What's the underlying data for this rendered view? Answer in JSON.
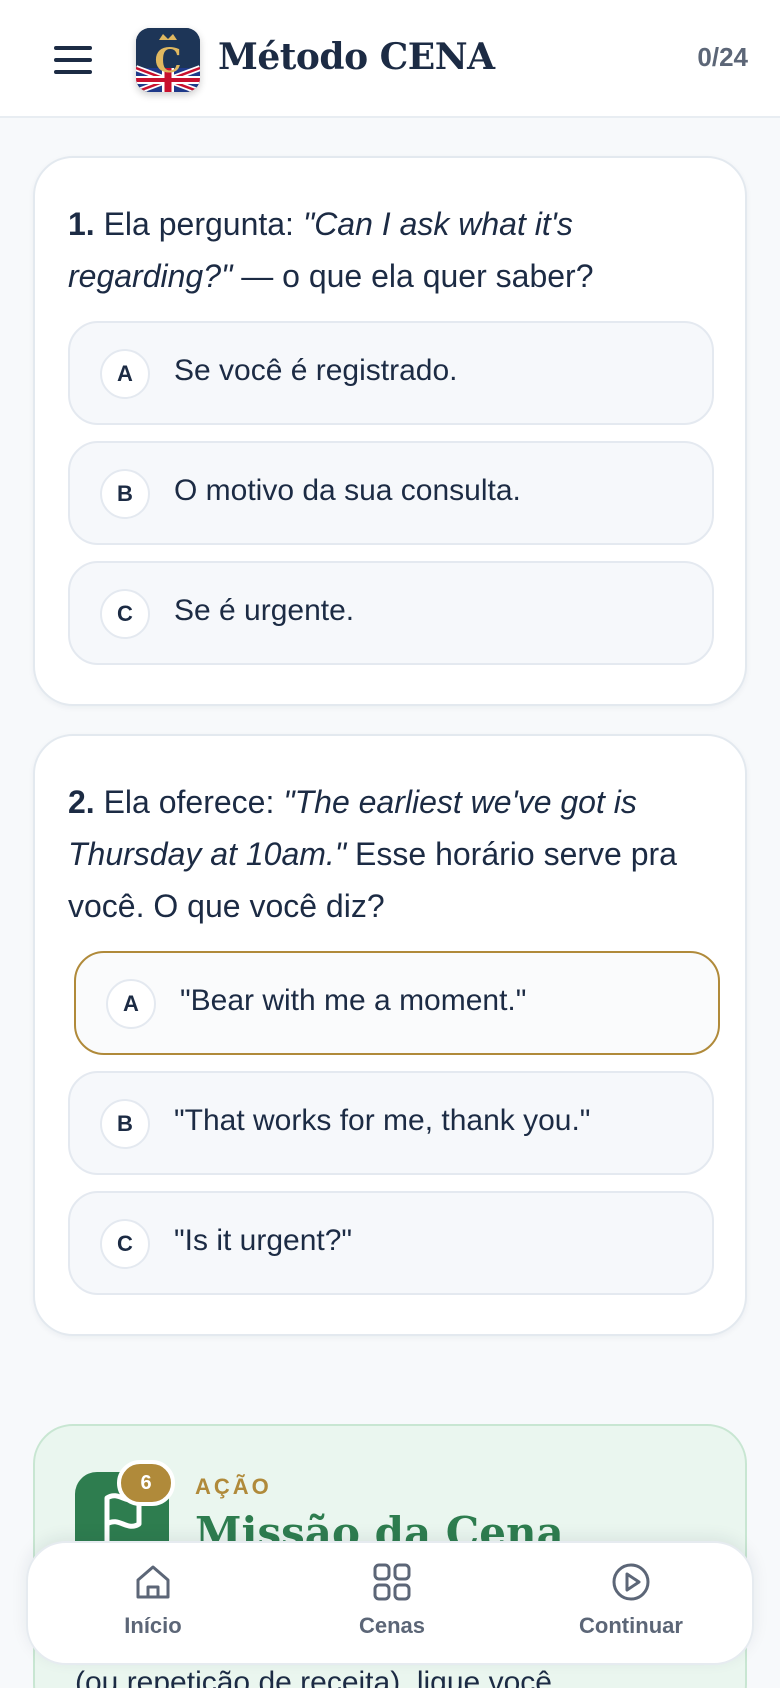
{
  "header": {
    "menu_icon": "hamburger-menu-icon",
    "logo_icon": "app-logo-crown-c-union-jack",
    "title": "Método CENA",
    "progress": "0/24"
  },
  "questions": [
    {
      "number": "1.",
      "prompt_before": "Ela pergunta:",
      "quote": "\"Can I ask what it's regarding?\"",
      "prompt_after": "— o que ela quer saber?",
      "options": [
        {
          "letter": "A",
          "text": "Se você é registrado.",
          "selected": false
        },
        {
          "letter": "B",
          "text": "O motivo da sua consulta.",
          "selected": false
        },
        {
          "letter": "C",
          "text": "Se é urgente.",
          "selected": false
        }
      ]
    },
    {
      "number": "2.",
      "prompt_before": "Ela oferece:",
      "quote": "\"The earliest we've got is Thursday at 10am.\"",
      "prompt_after": "Esse horário serve pra você. O que você diz?",
      "options": [
        {
          "letter": "A",
          "text": "\"Bear with me a moment.\"",
          "selected": true
        },
        {
          "letter": "B",
          "text": "\"That works for me, thank you.\"",
          "selected": false
        },
        {
          "letter": "C",
          "text": "\"Is it urgent?\"",
          "selected": false
        }
      ]
    }
  ],
  "mission": {
    "icon": "flag-icon",
    "count": "6",
    "kicker": "AÇÃO",
    "title": "Missão da Cena",
    "body_partial": "(ou repetição de receita), ligue você"
  },
  "nav": [
    {
      "icon": "home-icon",
      "label": "Início"
    },
    {
      "icon": "grid-icon",
      "label": "Cenas"
    },
    {
      "icon": "play-circle-icon",
      "label": "Continuar"
    }
  ],
  "colors": {
    "navy": "#1c2b44",
    "gold": "#b08a3a",
    "green": "#2e7d4f",
    "muted": "#5c6677"
  }
}
